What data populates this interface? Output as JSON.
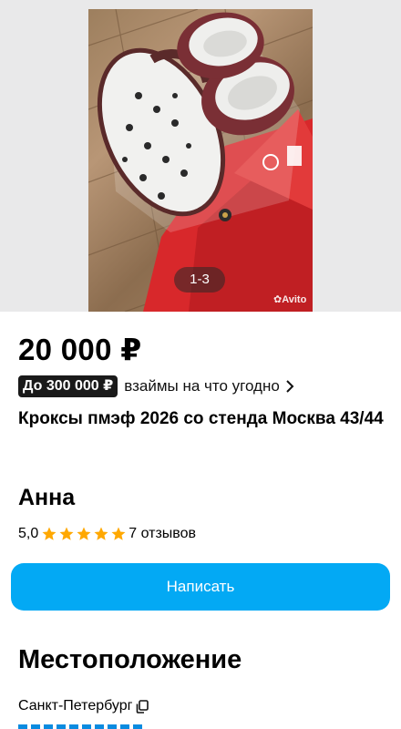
{
  "gallery": {
    "counter": "1-3",
    "watermark": "Avito"
  },
  "listing": {
    "price": "20 000 ₽",
    "loan_badge": "До 300 000 ₽",
    "loan_text": "взаймы на что угодно",
    "title": "Кроксы пмэф 2026 со стенда Москва 43/44"
  },
  "seller": {
    "name": "Анна",
    "rating": "5,0",
    "stars": 5,
    "reviews": "7 отзывов"
  },
  "actions": {
    "write_label": "Написать"
  },
  "location": {
    "heading": "Местоположение",
    "city": "Санкт-Петербург"
  },
  "colors": {
    "accent": "#03a9f4",
    "star": "#ffa800",
    "badge": "#1a1a1a"
  }
}
